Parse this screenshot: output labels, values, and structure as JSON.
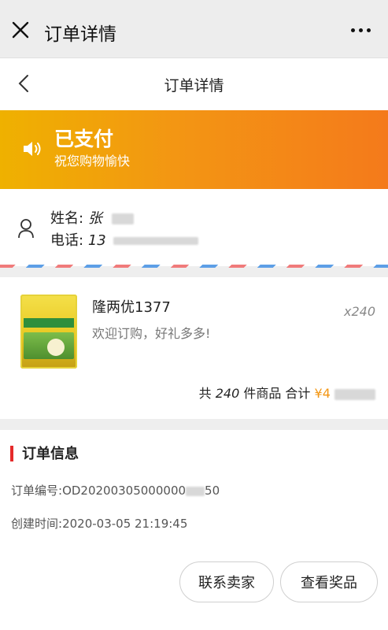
{
  "window": {
    "title": "订单详情"
  },
  "nav": {
    "title": "订单详情"
  },
  "status": {
    "title": "已支付",
    "subtitle": "祝您购物愉快"
  },
  "contact": {
    "name_label": "姓名:",
    "name_value": "张",
    "phone_label": "电话:",
    "phone_value": "13"
  },
  "goods": {
    "name": "隆两优1377",
    "slogan": "欢迎订购，好礼多多!",
    "quantity": "x240",
    "summary_prefix": "共",
    "summary_count": "240",
    "summary_suffix": "件商品 合计",
    "currency": "¥",
    "total_visible": "4"
  },
  "order": {
    "section_title": "订单信息",
    "number_label": "订单编号:",
    "number_value_start": "OD20200305000000",
    "number_value_end": "50",
    "created_label": "创建时间:",
    "created_value": "2020-03-05 21:19:45"
  },
  "actions": {
    "contact_seller": "联系卖家",
    "view_prize": "查看奖品"
  },
  "colors": {
    "banner_start": "#efb100",
    "banner_end": "#f47a1b",
    "accent_red": "#e52a2a"
  }
}
